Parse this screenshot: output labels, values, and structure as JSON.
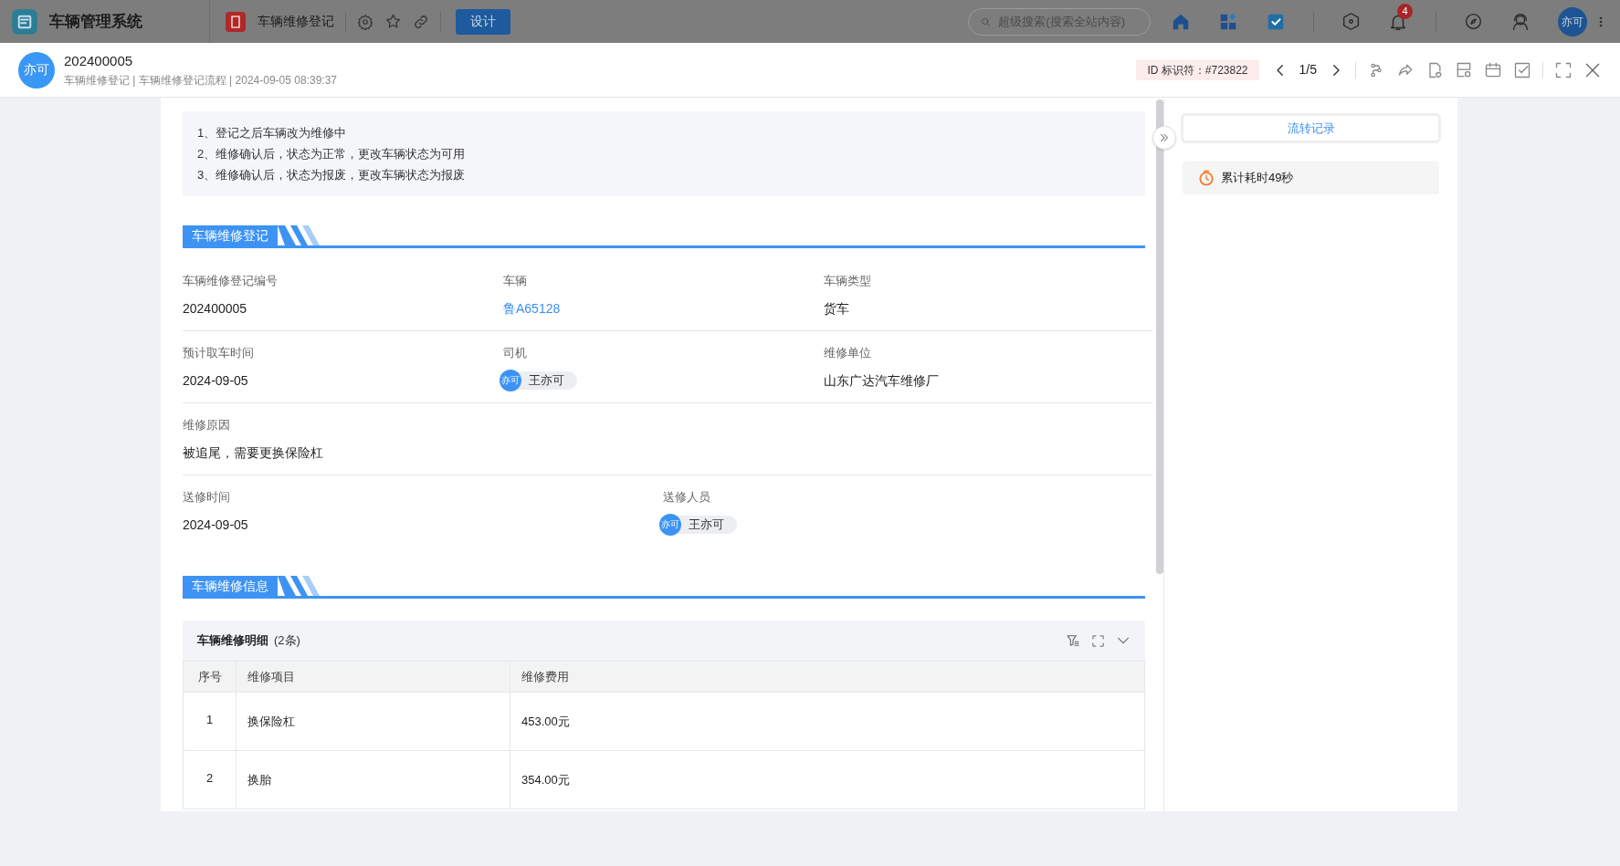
{
  "app_bar": {
    "app_name": "车辆管理系统",
    "page_tab": "车辆维修登记",
    "design_button": "设计",
    "search": {
      "placeholder": "超级搜索(搜索全站内容)"
    },
    "notification_count": "4",
    "avatar": "亦可"
  },
  "record_header": {
    "avatar": "亦可",
    "title": "202400005",
    "subtitle": "车辆维修登记 | 车辆维修登记流程 | 2024-09-05 08:39:37",
    "id_label": "ID 标识符：#723822",
    "pager": "1/5"
  },
  "notes": [
    "1、登记之后车辆改为维修中",
    "2、维修确认后，状态为正常，更改车辆状态为可用",
    "3、维修确认后，状态为报废，更改车辆状态为报废"
  ],
  "sections": [
    {
      "title": "车辆维修登记",
      "rows": [
        [
          {
            "label": "车辆维修登记编号",
            "kind": "text",
            "value": "202400005"
          },
          {
            "label": "车辆",
            "kind": "link",
            "value": "鲁A65128"
          },
          {
            "label": "车辆类型",
            "kind": "text",
            "value": "货车"
          }
        ],
        [
          {
            "label": "预计取车时间",
            "kind": "text",
            "value": "2024-09-05"
          },
          {
            "label": "司机",
            "kind": "user",
            "avatar": "亦可",
            "value": "王亦可"
          },
          {
            "label": "维修单位",
            "kind": "text",
            "value": "山东广达汽车维修厂"
          }
        ],
        [
          {
            "label": "维修原因",
            "kind": "text",
            "value": "被追尾，需要更换保险杠"
          }
        ],
        [
          {
            "label": "送修时间",
            "kind": "text",
            "value": "2024-09-05"
          },
          {
            "label": "送修人员",
            "kind": "user",
            "avatar": "亦可",
            "value": "王亦可"
          }
        ]
      ]
    },
    {
      "title": "车辆维修信息",
      "table": {
        "title": "车辆维修明细",
        "count": "(2条)",
        "columns": [
          "序号",
          "维修项目",
          "维修费用"
        ],
        "rows": [
          [
            "1",
            "换保险杠",
            "453.00元"
          ],
          [
            "2",
            "换胎",
            "354.00元"
          ]
        ]
      }
    }
  ],
  "side_panel": {
    "tab": "流转记录",
    "elapsed": "累计耗时49秒"
  }
}
